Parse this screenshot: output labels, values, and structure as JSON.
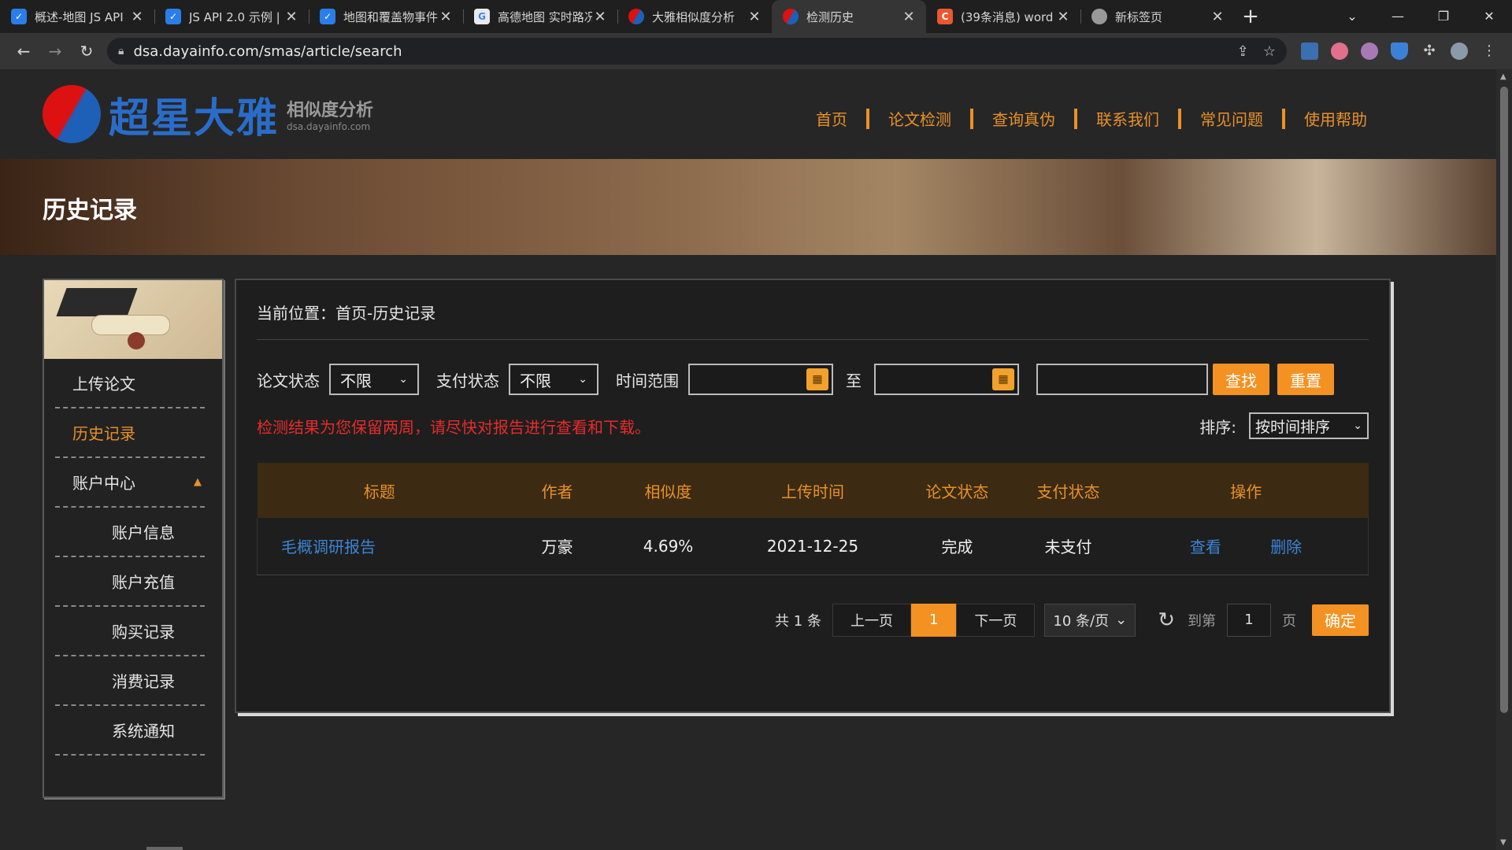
{
  "browser": {
    "tabs": [
      {
        "title": "概述-地图 JS API",
        "favicon_color": "#2b7de9",
        "active": false
      },
      {
        "title": "JS API 2.0 示例 |",
        "favicon_color": "#2b7de9",
        "active": false
      },
      {
        "title": "地图和覆盖物事件",
        "favicon_color": "#2b7de9",
        "active": false
      },
      {
        "title": "高德地图 实时路况",
        "favicon_color": "#e8eaed",
        "active": false
      },
      {
        "title": "大雅相似度分析",
        "favicon_color": "#d11",
        "active": false
      },
      {
        "title": "检测历史",
        "favicon_color": "#d11",
        "active": true
      },
      {
        "title": "(39条消息) word",
        "favicon_color": "#e9582e",
        "active": false
      },
      {
        "title": "新标签页",
        "favicon_color": "#999",
        "active": false
      }
    ],
    "url": "dsa.dayainfo.com/smas/article/search"
  },
  "header": {
    "logo_text": "超星大雅",
    "logo_sub_1": "相似度分析",
    "logo_sub_2": "dsa.dayainfo.com",
    "nav": [
      "首页",
      "论文检测",
      "查询真伪",
      "联系我们",
      "常见问题",
      "使用帮助"
    ]
  },
  "banner": {
    "title": "历史记录"
  },
  "sidebar": {
    "items": [
      {
        "label": "上传论文",
        "active": false,
        "sub": false
      },
      {
        "label": "历史记录",
        "active": true,
        "sub": false
      },
      {
        "label": "账户中心",
        "active": false,
        "sub": false,
        "expandable": true
      },
      {
        "label": "账户信息",
        "active": false,
        "sub": true
      },
      {
        "label": "账户充值",
        "active": false,
        "sub": true
      },
      {
        "label": "购买记录",
        "active": false,
        "sub": true
      },
      {
        "label": "消费记录",
        "active": false,
        "sub": true
      },
      {
        "label": "系统通知",
        "active": false,
        "sub": true
      }
    ]
  },
  "main": {
    "breadcrumb": "当前位置：首页-历史记录",
    "filters": {
      "paper_status_label": "论文状态",
      "paper_status_value": "不限",
      "pay_status_label": "支付状态",
      "pay_status_value": "不限",
      "time_range_label": "时间范围",
      "to_label": "至",
      "search_button": "查找",
      "reset_button": "重置"
    },
    "notice": "检测结果为您保留两周，请尽快对报告进行查看和下载。",
    "sort_label": "排序:",
    "sort_value": "按时间排序",
    "table": {
      "headers": [
        "标题",
        "作者",
        "相似度",
        "上传时间",
        "论文状态",
        "支付状态",
        "操作"
      ],
      "rows": [
        {
          "title": "毛概调研报告",
          "author": "万豪",
          "similarity": "4.69%",
          "upload_time": "2021-12-25",
          "paper_status": "完成",
          "pay_status": "未支付",
          "action_view": "查看",
          "action_delete": "删除"
        }
      ]
    },
    "pager": {
      "total": "共 1 条",
      "prev": "上一页",
      "current": "1",
      "next": "下一页",
      "page_size": "10 条/页",
      "goto_label": "到第",
      "goto_value": "1",
      "page_suffix": "页",
      "confirm": "确定"
    }
  },
  "colors": {
    "accent": "#f39222",
    "nav_orange": "#e8912a",
    "notice_red": "#e62b2b",
    "link_blue": "#3d84d6"
  }
}
